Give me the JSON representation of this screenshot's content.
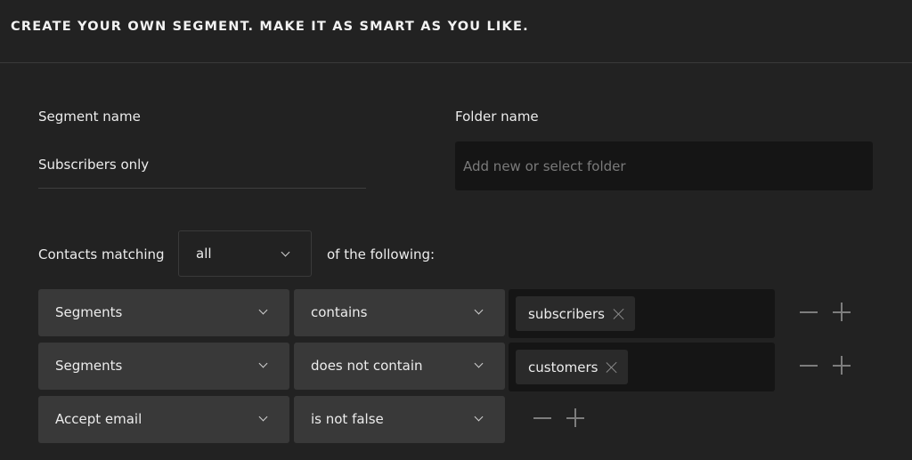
{
  "header": {
    "title": "CREATE YOUR OWN SEGMENT. MAKE IT AS SMART AS YOU LIKE."
  },
  "segment_name": {
    "label": "Segment name",
    "value": "Subscribers only"
  },
  "folder_name": {
    "label": "Folder name",
    "value": "",
    "placeholder": "Add new or select folder"
  },
  "matching": {
    "prefix": "Contacts matching",
    "selected": "all",
    "suffix": "of the following:"
  },
  "rules": [
    {
      "field": "Segments",
      "operator": "contains",
      "tags": [
        "subscribers"
      ]
    },
    {
      "field": "Segments",
      "operator": "does not contain",
      "tags": [
        "customers"
      ]
    },
    {
      "field": "Accept email",
      "operator": "is not false",
      "tags": []
    }
  ],
  "icons": {
    "dropdown": "chevron-down-icon",
    "remove_tag": "close-icon",
    "remove_rule": "minus-icon",
    "add_rule": "plus-icon"
  }
}
